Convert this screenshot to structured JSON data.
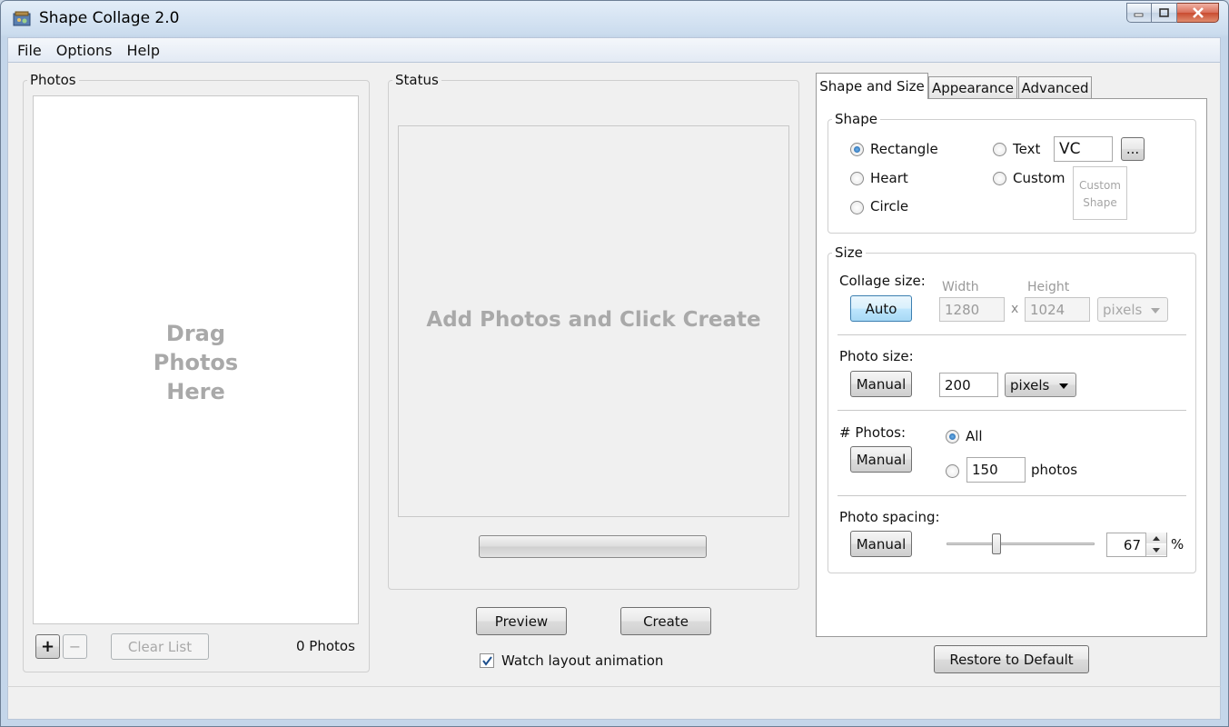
{
  "window": {
    "title": "Shape Collage 2.0"
  },
  "menu": {
    "items": [
      "File",
      "Options",
      "Help"
    ]
  },
  "photos": {
    "group_title": "Photos",
    "drop_lines": [
      "Drag",
      "Photos",
      "Here"
    ],
    "add_label": "+",
    "remove_label": "−",
    "clear_label": "Clear List",
    "count_label": "0 Photos"
  },
  "status": {
    "group_title": "Status",
    "placeholder": "Add Photos and Click Create",
    "progress": 0,
    "preview_label": "Preview",
    "create_label": "Create",
    "watch_label": "Watch layout animation",
    "watch_checked": true
  },
  "tabs": [
    "Shape and Size",
    "Appearance",
    "Advanced"
  ],
  "shape": {
    "group_title": "Shape",
    "rectangle": "Rectangle",
    "heart": "Heart",
    "circle": "Circle",
    "text": "Text",
    "text_value": "VC",
    "browse_label": "...",
    "custom": "Custom",
    "custom_shape_lines": [
      "Custom",
      "Shape"
    ],
    "selected": "Rectangle"
  },
  "size": {
    "group_title": "Size",
    "collage_size_label": "Collage size:",
    "collage_mode": "Auto",
    "width_label": "Width",
    "height_label": "Height",
    "width_value": "1280",
    "times": "x",
    "height_value": "1024",
    "collage_unit": "pixels",
    "photo_size_label": "Photo size:",
    "photo_size_mode": "Manual",
    "photo_size_value": "200",
    "photo_size_unit": "pixels",
    "num_photos_label": "# Photos:",
    "num_photos_mode": "Manual",
    "all_label": "All",
    "num_photos_value": "150",
    "photos_unit": "photos",
    "spacing_label": "Photo spacing:",
    "spacing_mode": "Manual",
    "spacing_value": "67",
    "spacing_unit": "%"
  },
  "restore_label": "Restore to Default",
  "colors": {
    "accent": "#3c7fb1",
    "placeholder_text": "#a9a9a9",
    "radio_dot": "#1a5fa6"
  }
}
